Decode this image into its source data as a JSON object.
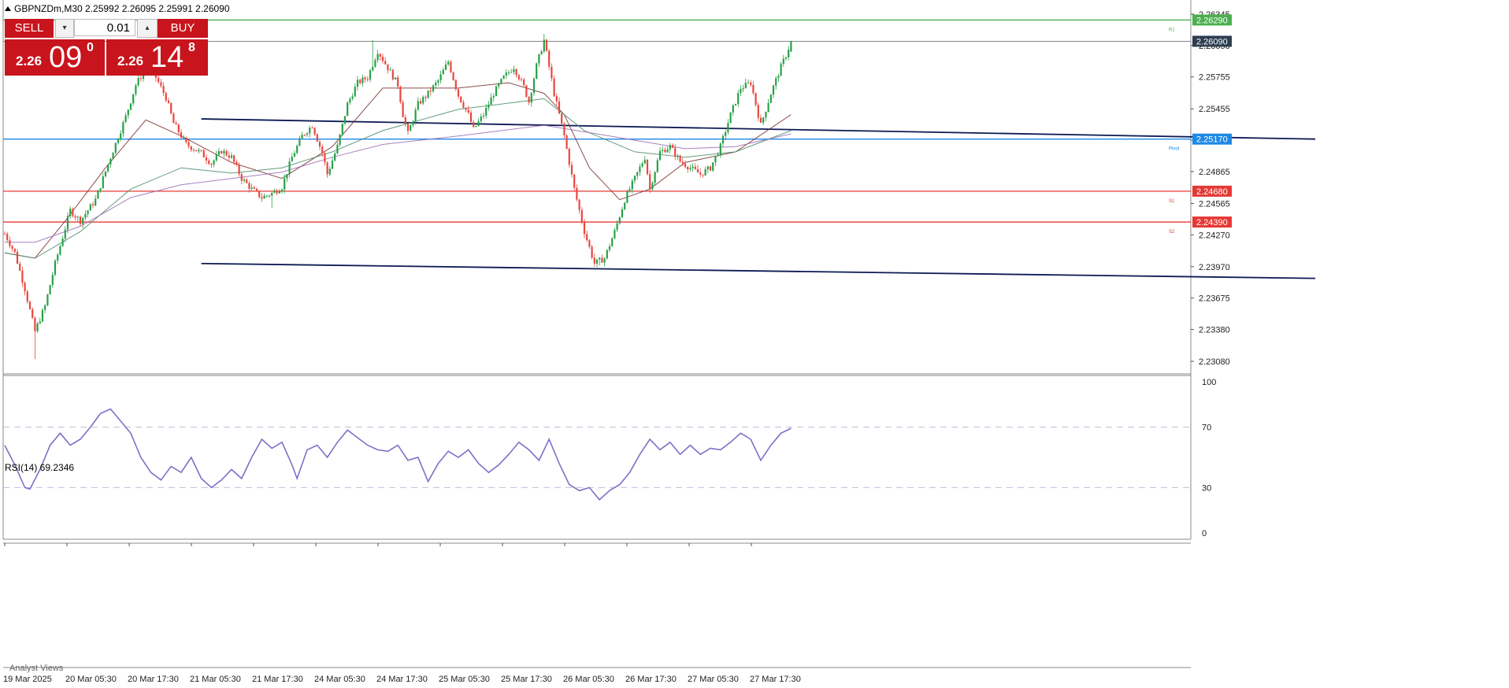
{
  "header": {
    "symbol_line": "GBPNZDm,M30  2.25992 2.26095 2.25991 2.26090"
  },
  "trade_panel": {
    "sell_label": "SELL",
    "buy_label": "BUY",
    "lot_value": "0.01",
    "sell_price_prefix": "2.26",
    "sell_price_big": "09",
    "sell_price_sup": "0",
    "buy_price_prefix": "2.26",
    "buy_price_big": "14",
    "buy_price_sup": "8",
    "dropdown_glyph": "▾",
    "up_glyph": "▴"
  },
  "rsi": {
    "label": "RSI(14) 69.2346",
    "ticks": [
      "100",
      "70",
      "30",
      "0"
    ]
  },
  "footer": {
    "analyst_text": "Analyst Views"
  },
  "colors": {
    "bull": "#27a048",
    "bear": "#e8473e",
    "level_red": "#e53935",
    "level_green": "#4caf50",
    "pivot_blue": "#1e88e5",
    "trendline": "#0d1a54",
    "rsi_line": "#7f6fc8",
    "ma_fast": "#7b2d2d",
    "ma_mid": "#4a8a6a",
    "ma_slow": "#9b6bb5",
    "current_price_bg": "#2c3e50"
  },
  "chart_data": {
    "type": "candlestick",
    "symbol": "GBPNZDm",
    "timeframe": "M30",
    "ohlc_current": {
      "open": 2.25992,
      "high": 2.26095,
      "low": 2.25991,
      "close": 2.2609
    },
    "y_axis_ticks": [
      "2.26345",
      "2.26050",
      "2.25755",
      "2.25455",
      "2.25160",
      "2.24865",
      "2.24565",
      "2.24270",
      "2.23970",
      "2.23675",
      "2.23380",
      "2.23080"
    ],
    "x_axis_ticks": [
      "19 Mar 2025",
      "20 Mar 05:30",
      "20 Mar 17:30",
      "21 Mar 05:30",
      "21 Mar 17:30",
      "24 Mar 05:30",
      "24 Mar 17:30",
      "25 Mar 05:30",
      "25 Mar 17:30",
      "26 Mar 05:30",
      "26 Mar 17:30",
      "27 Mar 05:30",
      "27 Mar 17:30"
    ],
    "ylim": [
      2.23,
      2.264
    ],
    "close_path": [
      [
        0,
        2.2428
      ],
      [
        4,
        2.241
      ],
      [
        8,
        2.2376
      ],
      [
        12,
        2.2336
      ],
      [
        16,
        2.236
      ],
      [
        20,
        2.24
      ],
      [
        26,
        2.245
      ],
      [
        30,
        2.244
      ],
      [
        36,
        2.246
      ],
      [
        42,
        2.25
      ],
      [
        48,
        2.2538
      ],
      [
        52,
        2.2568
      ],
      [
        56,
        2.2584
      ],
      [
        60,
        2.2575
      ],
      [
        64,
        2.2556
      ],
      [
        67,
        2.2532
      ],
      [
        72,
        2.2512
      ],
      [
        78,
        2.2504
      ],
      [
        82,
        2.2494
      ],
      [
        86,
        2.2506
      ],
      [
        90,
        2.25
      ],
      [
        94,
        2.248
      ],
      [
        98,
        2.247
      ],
      [
        102,
        2.2462
      ],
      [
        106,
        2.2466
      ],
      [
        110,
        2.2472
      ],
      [
        114,
        2.25
      ],
      [
        118,
        2.252
      ],
      [
        122,
        2.253
      ],
      [
        126,
        2.2504
      ],
      [
        128,
        2.2484
      ],
      [
        132,
        2.251
      ],
      [
        136,
        2.255
      ],
      [
        140,
        2.257
      ],
      [
        144,
        2.2575
      ],
      [
        148,
        2.26
      ],
      [
        152,
        2.2584
      ],
      [
        156,
        2.2568
      ],
      [
        158,
        2.254
      ],
      [
        160,
        2.2522
      ],
      [
        164,
        2.255
      ],
      [
        168,
        2.256
      ],
      [
        172,
        2.2572
      ],
      [
        176,
        2.259
      ],
      [
        180,
        2.2558
      ],
      [
        184,
        2.254
      ],
      [
        186,
        2.2526
      ],
      [
        190,
        2.254
      ],
      [
        194,
        2.256
      ],
      [
        198,
        2.2575
      ],
      [
        202,
        2.2585
      ],
      [
        206,
        2.2566
      ],
      [
        208,
        2.2552
      ],
      [
        211,
        2.2586
      ],
      [
        214,
        2.261
      ],
      [
        218,
        2.256
      ],
      [
        222,
        2.252
      ],
      [
        226,
        2.247
      ],
      [
        230,
        2.243
      ],
      [
        234,
        2.24
      ],
      [
        238,
        2.2405
      ],
      [
        242,
        2.243
      ],
      [
        246,
        2.246
      ],
      [
        250,
        2.248
      ],
      [
        254,
        2.25
      ],
      [
        256,
        2.247
      ],
      [
        260,
        2.2505
      ],
      [
        264,
        2.251
      ],
      [
        268,
        2.2496
      ],
      [
        272,
        2.249
      ],
      [
        276,
        2.2484
      ],
      [
        280,
        2.249
      ],
      [
        284,
        2.251
      ],
      [
        288,
        2.254
      ],
      [
        292,
        2.2565
      ],
      [
        296,
        2.257
      ],
      [
        300,
        2.253
      ],
      [
        304,
        2.256
      ],
      [
        308,
        2.2585
      ],
      [
        310,
        2.2596
      ],
      [
        312,
        2.2609
      ]
    ],
    "high_extremes": [
      {
        "bar": 58,
        "value": 2.2586
      },
      {
        "bar": 146,
        "value": 2.261
      },
      {
        "bar": 214,
        "value": 2.2616
      },
      {
        "bar": 312,
        "value": 2.26095
      }
    ],
    "low_extremes": [
      {
        "bar": 12,
        "value": 2.231
      },
      {
        "bar": 106,
        "value": 2.2452
      },
      {
        "bar": 236,
        "value": 2.2398
      }
    ],
    "moving_averages": [
      {
        "key": "ma_fast",
        "points": [
          [
            0,
            2.241
          ],
          [
            12,
            2.2405
          ],
          [
            24,
            2.244
          ],
          [
            40,
            2.249
          ],
          [
            56,
            2.2535
          ],
          [
            70,
            2.252
          ],
          [
            90,
            2.2495
          ],
          [
            110,
            2.248
          ],
          [
            130,
            2.251
          ],
          [
            150,
            2.2565
          ],
          [
            180,
            2.2565
          ],
          [
            200,
            2.257
          ],
          [
            214,
            2.256
          ],
          [
            222,
            2.254
          ],
          [
            232,
            2.249
          ],
          [
            244,
            2.246
          ],
          [
            256,
            2.247
          ],
          [
            270,
            2.2495
          ],
          [
            290,
            2.2505
          ],
          [
            312,
            2.254
          ]
        ]
      },
      {
        "key": "ma_mid",
        "points": [
          [
            0,
            2.241
          ],
          [
            12,
            2.2405
          ],
          [
            30,
            2.243
          ],
          [
            50,
            2.247
          ],
          [
            70,
            2.249
          ],
          [
            90,
            2.2485
          ],
          [
            110,
            2.249
          ],
          [
            130,
            2.2505
          ],
          [
            150,
            2.2525
          ],
          [
            180,
            2.2545
          ],
          [
            214,
            2.2555
          ],
          [
            230,
            2.2525
          ],
          [
            250,
            2.2505
          ],
          [
            270,
            2.25
          ],
          [
            290,
            2.2505
          ],
          [
            312,
            2.2525
          ]
        ]
      },
      {
        "key": "ma_slow",
        "points": [
          [
            0,
            2.242
          ],
          [
            12,
            2.242
          ],
          [
            30,
            2.2435
          ],
          [
            50,
            2.2462
          ],
          [
            70,
            2.2474
          ],
          [
            90,
            2.248
          ],
          [
            110,
            2.2486
          ],
          [
            130,
            2.25
          ],
          [
            150,
            2.2512
          ],
          [
            180,
            2.252
          ],
          [
            214,
            2.253
          ],
          [
            240,
            2.252
          ],
          [
            270,
            2.2508
          ],
          [
            290,
            2.251
          ],
          [
            312,
            2.2522
          ]
        ]
      }
    ],
    "horizontal_levels": [
      {
        "key": "r1",
        "value": 2.2629,
        "label": "2.26290",
        "tag": "R1",
        "color_key": "level_green"
      },
      {
        "key": "current",
        "value": 2.2609,
        "label": "2.26090",
        "tag": "",
        "color_key": "current_price_bg"
      },
      {
        "key": "pivot",
        "value": 2.2517,
        "label": "2.25170",
        "tag": "Pivot",
        "color_key": "pivot_blue"
      },
      {
        "key": "s1",
        "value": 2.2468,
        "label": "2.24680",
        "tag": "S1",
        "color_key": "level_red"
      },
      {
        "key": "s2",
        "value": 2.2439,
        "label": "2.24390",
        "tag": "S2",
        "color_key": "level_red"
      }
    ],
    "trendlines": [
      {
        "from": [
          78,
          2.2536
        ],
        "to": [
          520,
          2.2517
        ]
      },
      {
        "from": [
          78,
          2.24
        ],
        "to": [
          520,
          2.2386
        ]
      }
    ],
    "rsi": {
      "period": 14,
      "last": 69.2346,
      "levels": [
        70,
        30
      ],
      "ylim": [
        0,
        100
      ],
      "path": [
        [
          0,
          58
        ],
        [
          4,
          45
        ],
        [
          8,
          30
        ],
        [
          10,
          29
        ],
        [
          14,
          42
        ],
        [
          18,
          58
        ],
        [
          22,
          66
        ],
        [
          26,
          58
        ],
        [
          30,
          62
        ],
        [
          34,
          70
        ],
        [
          38,
          79
        ],
        [
          42,
          82
        ],
        [
          46,
          74
        ],
        [
          50,
          66
        ],
        [
          54,
          50
        ],
        [
          58,
          40
        ],
        [
          62,
          35
        ],
        [
          66,
          44
        ],
        [
          70,
          40
        ],
        [
          74,
          50
        ],
        [
          78,
          36
        ],
        [
          82,
          30
        ],
        [
          86,
          35
        ],
        [
          90,
          42
        ],
        [
          94,
          36
        ],
        [
          98,
          50
        ],
        [
          102,
          62
        ],
        [
          106,
          56
        ],
        [
          110,
          60
        ],
        [
          114,
          45
        ],
        [
          116,
          36
        ],
        [
          120,
          55
        ],
        [
          124,
          58
        ],
        [
          128,
          50
        ],
        [
          132,
          60
        ],
        [
          136,
          68
        ],
        [
          140,
          63
        ],
        [
          144,
          58
        ],
        [
          148,
          55
        ],
        [
          152,
          54
        ],
        [
          156,
          58
        ],
        [
          160,
          48
        ],
        [
          164,
          50
        ],
        [
          168,
          34
        ],
        [
          172,
          46
        ],
        [
          176,
          54
        ],
        [
          180,
          50
        ],
        [
          184,
          55
        ],
        [
          188,
          46
        ],
        [
          192,
          40
        ],
        [
          196,
          45
        ],
        [
          200,
          52
        ],
        [
          204,
          60
        ],
        [
          208,
          55
        ],
        [
          212,
          48
        ],
        [
          216,
          62
        ],
        [
          220,
          46
        ],
        [
          224,
          32
        ],
        [
          228,
          28
        ],
        [
          232,
          30
        ],
        [
          236,
          22
        ],
        [
          240,
          28
        ],
        [
          244,
          32
        ],
        [
          248,
          40
        ],
        [
          252,
          52
        ],
        [
          256,
          62
        ],
        [
          260,
          55
        ],
        [
          264,
          60
        ],
        [
          268,
          52
        ],
        [
          272,
          58
        ],
        [
          276,
          52
        ],
        [
          280,
          56
        ],
        [
          284,
          55
        ],
        [
          288,
          60
        ],
        [
          292,
          66
        ],
        [
          296,
          62
        ],
        [
          300,
          48
        ],
        [
          304,
          58
        ],
        [
          308,
          66
        ],
        [
          312,
          69.23
        ]
      ]
    }
  }
}
